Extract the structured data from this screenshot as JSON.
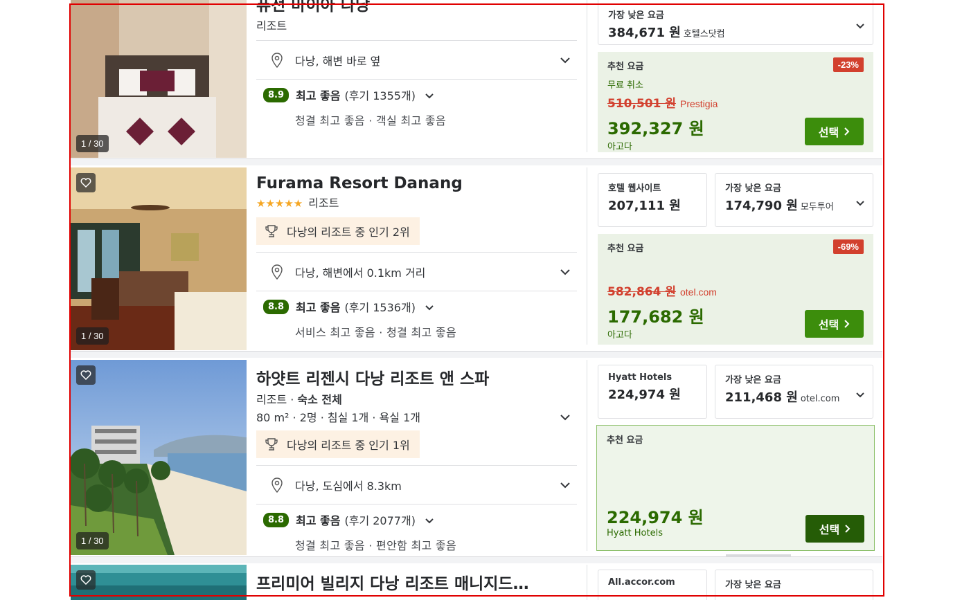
{
  "hotels": [
    {
      "name": "퓨전 마이아 다낭",
      "type": "리조트",
      "location": "다낭, 해변 바로 옆",
      "score": "8.9",
      "score_label": "최고 좋음",
      "reviews": "(후기 1355개)",
      "highlights": "청결 최고 좋음 · 객실 최고 좋음",
      "photo_counter": "1 / 30",
      "lowest": {
        "label": "가장 낮은 요금",
        "price": "384,671 원",
        "provider": "호텔스닷컴"
      },
      "recommended": {
        "label": "추천 요금",
        "discount": "-23%",
        "free_cancel": "무료 취소",
        "old_price": "510,501 원",
        "old_provider": "Prestigia",
        "price": "392,327 원",
        "provider": "아고다",
        "button": "선택"
      }
    },
    {
      "name": "Furama Resort Danang",
      "stars": "★★★★★",
      "type": "리조트",
      "popular": "다낭의 리조트 중 인기 2위",
      "location": "다낭, 해변에서 0.1km 거리",
      "score": "8.8",
      "score_label": "최고 좋음",
      "reviews": "(후기 1536개)",
      "highlights": "서비스 최고 좋음 · 청결 최고 좋음",
      "photo_counter": "1 / 30",
      "site": {
        "label": "호텔 웹사이트",
        "price": "207,111 원"
      },
      "lowest": {
        "label": "가장 낮은 요금",
        "price": "174,790 원",
        "provider": "모두투어"
      },
      "recommended": {
        "label": "추천 요금",
        "discount": "-69%",
        "old_price": "582,864 원",
        "old_provider": "otel.com",
        "price": "177,682 원",
        "provider": "아고다",
        "button": "선택"
      }
    },
    {
      "name": "하얏트 리젠시 다낭 리조트 앤 스파",
      "type": "리조트 · ",
      "type_bold": "숙소 전체",
      "rooms": "80 m² · 2명 · 침실 1개 · 욕실 1개",
      "popular": "다낭의 리조트 중 인기 1위",
      "location": "다낭, 도심에서 8.3km",
      "score": "8.8",
      "score_label": "최고 좋음",
      "reviews": "(후기 2077개)",
      "highlights": "청결 최고 좋음 · 편안함 최고 좋음",
      "photo_counter": "1 / 30",
      "site": {
        "label": "Hyatt Hotels",
        "price": "224,974 원"
      },
      "lowest": {
        "label": "가장 낮은 요금",
        "price": "211,468 원",
        "provider": "otel.com"
      },
      "recommended": {
        "label": "추천 요금",
        "price": "224,974 원",
        "provider": "Hyatt Hotels",
        "button": "선택"
      }
    },
    {
      "name": "프리미어 빌리지 다낭 리조트 매니지드…",
      "site": {
        "label": "All.accor.com"
      },
      "lowest": {
        "label": "가장 낮은 요금"
      }
    }
  ]
}
